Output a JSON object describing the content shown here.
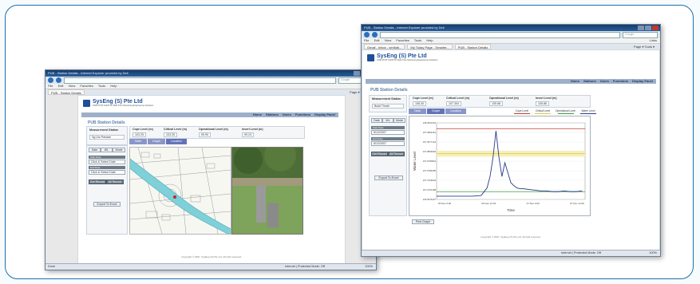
{
  "left_window": {
    "title": "PUB - Station Details - Internet Explorer provided by Dell",
    "search_placeholder": "Google",
    "menu": [
      "File",
      "Edit",
      "View",
      "Favorites",
      "Tools",
      "Help"
    ],
    "menu_right": "Links",
    "tabs": [
      "PUB - Station Details"
    ],
    "tool_controls": "Page ▾  Tools ▾",
    "logo_name": "SysEng (S) Pte Ltd",
    "logo_tagline": "ONE STOP SHOP for Real Time Monitoring Engineering Solutions",
    "nav": [
      "Home",
      "Stations",
      "Users",
      "Functions",
      "Display Panel"
    ],
    "section_title": "PUB Station Details",
    "measurement_label": "Measurement Station",
    "station_value": "Sg Ulu Pandan",
    "levels": [
      {
        "label": "Cope Level (m)",
        "value": "103.25"
      },
      {
        "label": "Critical Level (m)",
        "value": "103.25"
      },
      {
        "label": "Operational Level (m)",
        "value": "99.90"
      },
      {
        "label": "Invert Level (m)",
        "value": "99.24"
      }
    ],
    "view_tabs": [
      "Table",
      "Graph",
      "Location"
    ],
    "side_tabs": [
      "Date",
      "WL",
      "Mode"
    ],
    "start_label": "Start Date",
    "start_value": "Click & Select Date",
    "end_label": "End Date",
    "end_value": "Click & Select Date",
    "get_record": "Get Record",
    "all_record": "All Record",
    "export": "Export To Excel",
    "footer": "Copyright © 2007. SysEng (S) Pte Ltd. All right reserved.",
    "status_left": "Done",
    "status_mid": "Internet | Protected Mode: Off",
    "status_zoom": "100%"
  },
  "right_window": {
    "title": "PUB - Station Details - Internet Explorer provided by Dell",
    "search_placeholder": "Google",
    "menu": [
      "File",
      "Edit",
      "View",
      "Favorites",
      "Tools",
      "Help"
    ],
    "menu_right": "Links",
    "tabs": [
      "Gmail - Inbox - seriilab...",
      "My Today Page - Smarter...",
      "PUB - Station Details"
    ],
    "tool_controls": "Page ▾  Tools ▾",
    "logo_name": "SysEng (S) Pte Ltd",
    "logo_tagline": "ONE STOP SHOP for Real Time Monitoring Engineering Solutions",
    "nav": [
      "Home",
      "Stations",
      "Users",
      "Functions",
      "Display Panel"
    ],
    "section_title": "PUB Station Details",
    "measurement_label": "Measurement Station",
    "station_value": "Bukit Timah",
    "levels": [
      {
        "label": "Cope Level (m)",
        "value": "108.30"
      },
      {
        "label": "Critical Level (m)",
        "value": "107.304"
      },
      {
        "label": "Operational Level (m)",
        "value": "105.68"
      },
      {
        "label": "Invert Level (m)",
        "value": "105.86"
      }
    ],
    "view_tabs": [
      "Table",
      "Graph",
      "Location"
    ],
    "side_tabs": [
      "Date",
      "WL",
      "Mode"
    ],
    "start_label": "Start Date",
    "start_value": "6/12/2007",
    "end_label": "End Date",
    "end_value": "8/12/2007",
    "get_record": "Get Record",
    "all_record": "All Record",
    "export": "Export To Excel",
    "print": "Print Graph",
    "footer": "Copyright © 2007. SysEng (S) Pte Ltd. All right reserved.",
    "status_mid": "Internet | Protected Mode: Off",
    "status_zoom": "100%"
  },
  "colors": {
    "cope": "#c0392b",
    "critical": "#d9c84a",
    "operational": "#3c9a3c",
    "water": "#283a8c",
    "river": "#7fd0d8"
  },
  "chart_data": {
    "type": "line",
    "title": "",
    "xlabel": "Time",
    "ylabel": "Water Level",
    "x_ticks": [
      "06 Dec 0:00",
      "06 Dec 12:00",
      "07 Dec 0:00",
      "07 Dec 12:00"
    ],
    "y_ticks": [
      "108.0061443",
      "107.0864261",
      "107.0677144",
      "107.8893994",
      "107.6780844",
      "107.6783255",
      "107.2709604",
      "107.0701188",
      "106.9976437"
    ],
    "ylim": [
      106.9976437,
      108.0061443
    ],
    "legend": [
      "Cope Level",
      "Critical Level",
      "Operational Level",
      "Water Level"
    ],
    "reference_lines": [
      {
        "name": "Cope Level",
        "y": 107.93
      },
      {
        "name": "Critical Level",
        "y": 107.6
      },
      {
        "name": "Operational Level",
        "y": 107.1
      }
    ],
    "series": [
      {
        "name": "Water Level",
        "x": [
          0,
          0.06,
          0.12,
          0.18,
          0.24,
          0.3,
          0.34,
          0.36,
          0.38,
          0.4,
          0.42,
          0.44,
          0.46,
          0.48,
          0.5,
          0.52,
          0.54,
          0.56,
          0.58,
          0.62,
          0.66,
          0.7,
          0.74,
          0.78,
          0.82,
          0.86,
          0.9,
          0.94,
          0.98
        ],
        "y": [
          107.04,
          107.04,
          107.04,
          107.04,
          107.04,
          107.05,
          107.15,
          107.3,
          107.55,
          107.9,
          107.55,
          107.3,
          107.48,
          107.35,
          107.22,
          107.18,
          107.15,
          107.14,
          107.14,
          107.13,
          107.12,
          107.11,
          107.11,
          107.1,
          107.1,
          107.11,
          107.1,
          107.1,
          107.11
        ]
      }
    ]
  }
}
